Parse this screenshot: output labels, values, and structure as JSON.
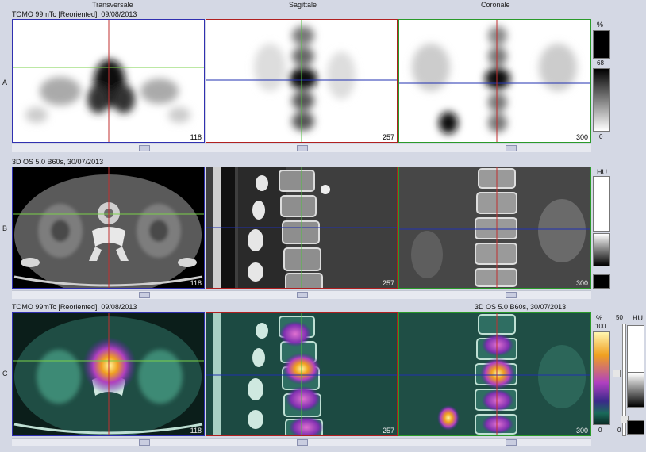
{
  "columns": {
    "transversale": "Transversale",
    "sagittale": "Sagittale",
    "coronale": "Coronale"
  },
  "rows": {
    "A": {
      "label": "A",
      "title": "TOMO 99mTc [Reoriented], 09/08/2013",
      "slices": [
        "118",
        "257",
        "300"
      ]
    },
    "B": {
      "label": "B",
      "title": "3D OS 5.0 B60s, 30/07/2013",
      "slices": [
        "118",
        "257",
        "300"
      ]
    },
    "C": {
      "label": "C",
      "title_left": "TOMO 99mTc [Reoriented], 09/08/2013",
      "title_right": "3D OS 5.0 B60s, 30/07/2013",
      "slices": [
        "118",
        "257",
        "300"
      ]
    }
  },
  "colorbars": {
    "A": {
      "unit": "%",
      "level": "68",
      "min": "0"
    },
    "B": {
      "unit": "HU"
    },
    "C": {
      "unit_pct": "%",
      "max": "100",
      "min": "0",
      "value": "50",
      "unit_hu": "HU",
      "hu_min": "0"
    }
  },
  "colors": {
    "accent_blue": "#3030b0",
    "accent_red": "#b02020",
    "accent_green": "#2a9a2a",
    "background": "#d4d8e4"
  }
}
